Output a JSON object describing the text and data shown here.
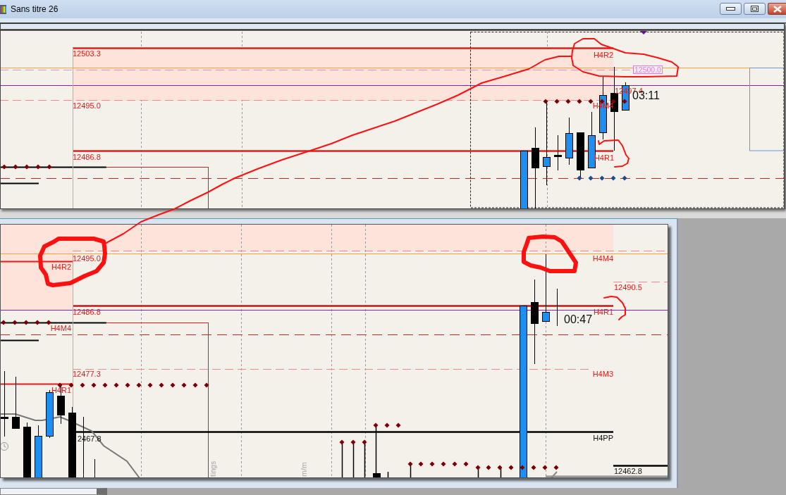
{
  "window": {
    "title": "Sans titre 26"
  },
  "top_chart": {
    "labels": [
      "12503.3",
      "H4R2",
      "12497.4",
      "12495.0",
      "H4M4",
      "12486.8",
      "H4R1"
    ],
    "price_tag": "12500.0",
    "timer": "03:11"
  },
  "bottom_chart": {
    "labels": [
      "12495.0",
      "H4M4",
      "H4R2",
      "12490.5",
      "12486.8",
      "H4R1",
      "H4M4",
      "12477.3",
      "H4M3",
      "H4R1",
      "2467.8",
      "H4PP",
      "12462.8"
    ],
    "timer": "00:47",
    "axis_labels": [
      "tings",
      "m/m"
    ]
  }
}
